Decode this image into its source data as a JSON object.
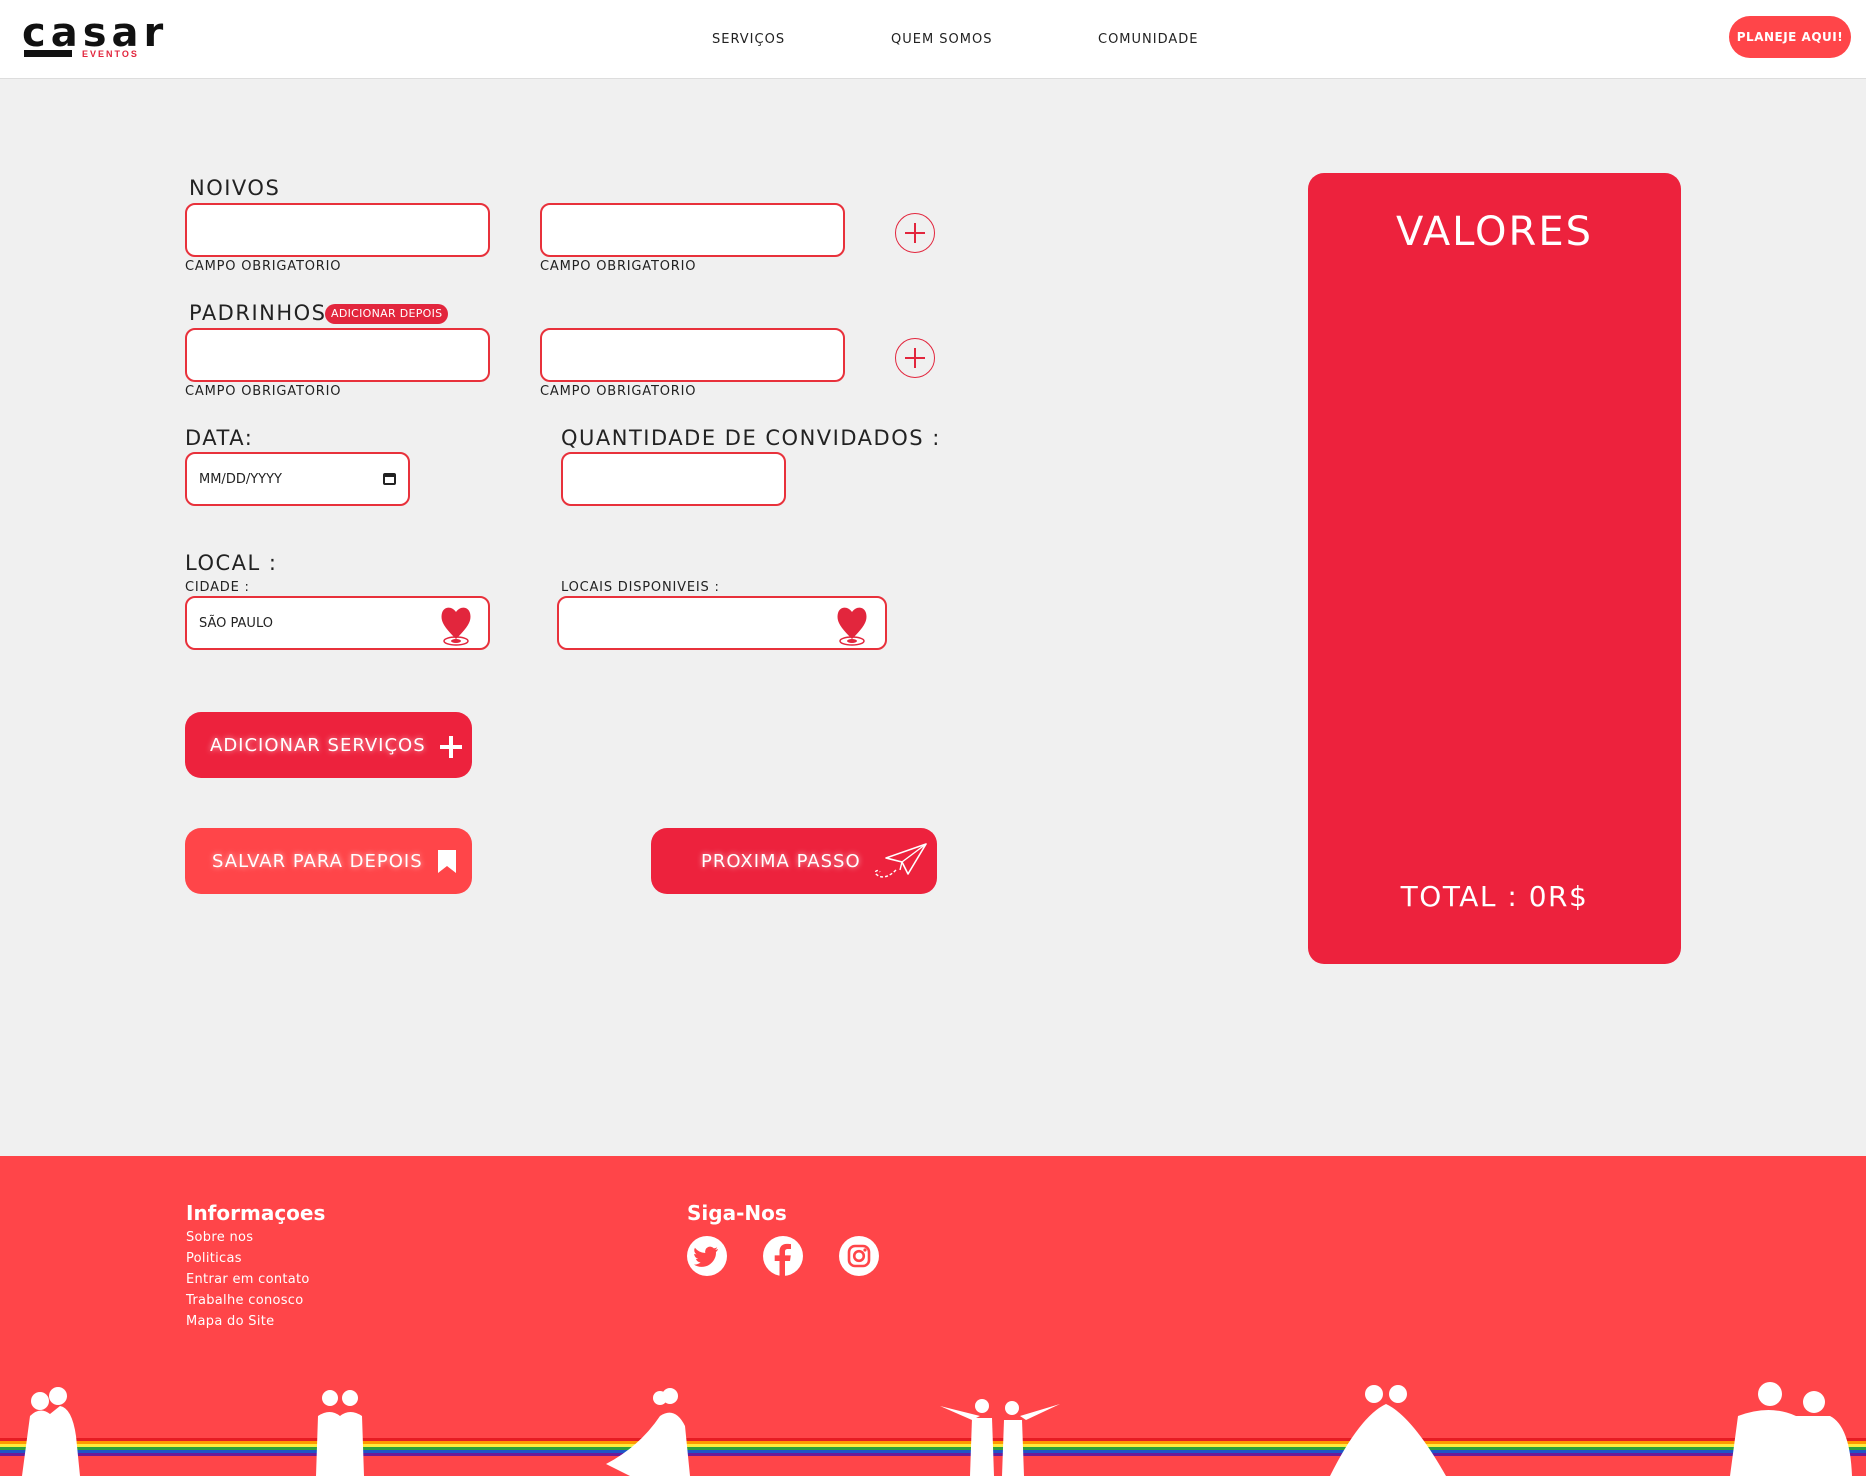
{
  "brand": {
    "name": "casar",
    "subtitle": "EVENTOS"
  },
  "nav": {
    "items": [
      "SERVIÇOS",
      "QUEM SOMOS",
      "COMUNIDADE"
    ],
    "cta": "PLANEJE AQUI!"
  },
  "form": {
    "noivos": {
      "label": "NOIVOS",
      "hint1": "CAMPO OBRIGATORIO",
      "hint2": "CAMPO OBRIGATORIO"
    },
    "padrinhos": {
      "label": "PADRINHOS",
      "badge": "ADICIONAR DEPOIS",
      "hint1": "CAMPO OBRIGATORIO",
      "hint2": "CAMPO OBRIGATORIO"
    },
    "data": {
      "label": "DATA:",
      "placeholder": "MM/DD/YYYY"
    },
    "convidados": {
      "label": "QUANTIDADE DE CONVIDADOS :"
    },
    "local": {
      "label": "LOCAL :",
      "cidade_label": "CIDADE :",
      "cidade_value": "SÃO PAULO",
      "locais_label": "LOCAIS DISPONIVEIS :"
    },
    "buttons": {
      "add_services": "ADICIONAR SERVIÇOS",
      "save_later": "SALVAR PARA DEPOIS",
      "next_step": "PROXIMA PASSO"
    }
  },
  "values_panel": {
    "title": "VALORES",
    "total": "TOTAL : 0R$"
  },
  "footer": {
    "info_title": "Informaçoes",
    "links": [
      "Sobre nos",
      "Politicas",
      "Entrar em contato",
      "Trabalhe conosco",
      "Mapa do Site"
    ],
    "social_title": "Siga-Nos",
    "social_icons": [
      "twitter-icon",
      "facebook-icon",
      "instagram-icon"
    ]
  },
  "colors": {
    "primary": "#ed223d",
    "footer": "#ff4549",
    "background": "#f0f0f0"
  }
}
